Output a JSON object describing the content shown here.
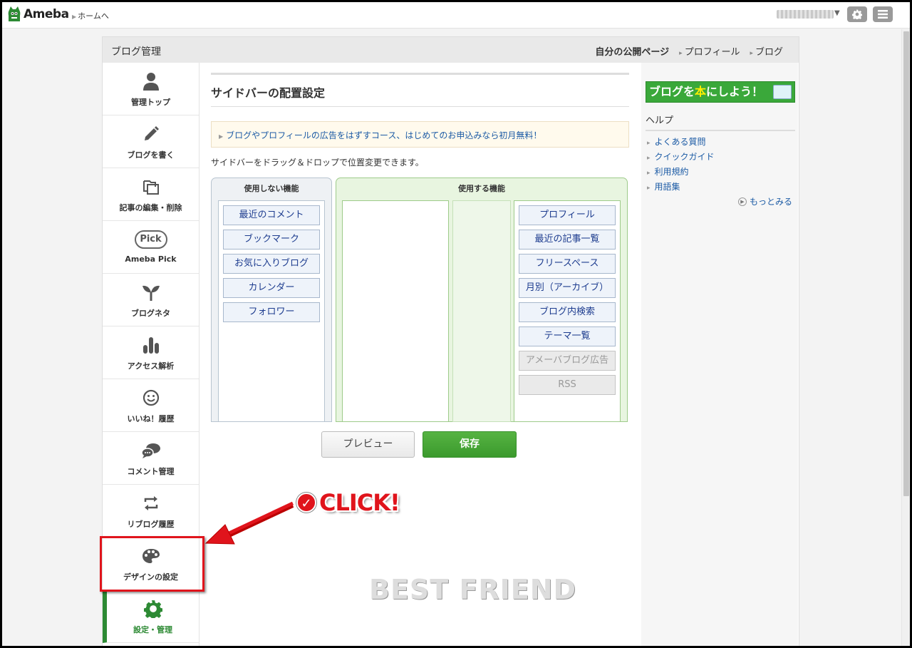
{
  "topbar": {
    "logo_text": "Ameba",
    "home_link": "ホームへ",
    "settings_icon": "gear-icon",
    "menu_icon": "hamburger-icon"
  },
  "panel": {
    "title": "ブログ管理",
    "links": {
      "own_page": "自分の公開ページ",
      "profile": "プロフィール",
      "blog": "ブログ"
    }
  },
  "sidenav": {
    "items": [
      {
        "label": "管理トップ",
        "icon": "person-icon"
      },
      {
        "label": "ブログを書く",
        "icon": "pencil-icon"
      },
      {
        "label": "記事の編集・削除",
        "icon": "documents-icon"
      },
      {
        "label": "Ameba Pick",
        "icon": "pick-icon",
        "icon_text": "Pick"
      },
      {
        "label": "ブログネタ",
        "icon": "sprout-icon"
      },
      {
        "label": "アクセス解析",
        "icon": "bar-chart-icon"
      },
      {
        "label": "いいね！履歴",
        "icon": "smile-icon"
      },
      {
        "label": "コメント管理",
        "icon": "speech-bubbles-icon"
      },
      {
        "label": "リブログ履歴",
        "icon": "reblog-icon"
      },
      {
        "label": "デザインの設定",
        "icon": "palette-icon"
      },
      {
        "label": "設定・管理",
        "icon": "gear-icon",
        "active": true
      }
    ]
  },
  "main": {
    "heading": "サイドバーの配置設定",
    "notice": "ブログやプロフィールの広告をはずすコース、はじめてのお申込みなら初月無料！",
    "description": "サイドバーをドラッグ＆ドロップで位置変更できます。",
    "unused_title": "使用しない機能",
    "used_title": "使用する機能",
    "unused_modules": [
      "最近のコメント",
      "ブックマーク",
      "お気に入りブログ",
      "カレンダー",
      "フォロワー"
    ],
    "used_modules": [
      {
        "label": "プロフィール",
        "disabled": false
      },
      {
        "label": "最近の記事一覧",
        "disabled": false
      },
      {
        "label": "フリースペース",
        "disabled": false
      },
      {
        "label": "月別（アーカイブ）",
        "disabled": false
      },
      {
        "label": "ブログ内検索",
        "disabled": false
      },
      {
        "label": "テーマ一覧",
        "disabled": false
      },
      {
        "label": "アメーバブログ広告",
        "disabled": true
      },
      {
        "label": "RSS",
        "disabled": true
      }
    ],
    "preview_button": "プレビュー",
    "save_button": "保存"
  },
  "rightcol": {
    "banner": {
      "pre": "ブログを",
      "hon": "本",
      "post": "にしよう！"
    },
    "help_title": "ヘルプ",
    "help_links": [
      "よくある質問",
      "クイックガイド",
      "利用規約",
      "用語集"
    ],
    "more": "もっとみる"
  },
  "annotation": {
    "click_text": "CLICK!",
    "watermark": "BEST FRIEND",
    "color": "#e0141c"
  }
}
